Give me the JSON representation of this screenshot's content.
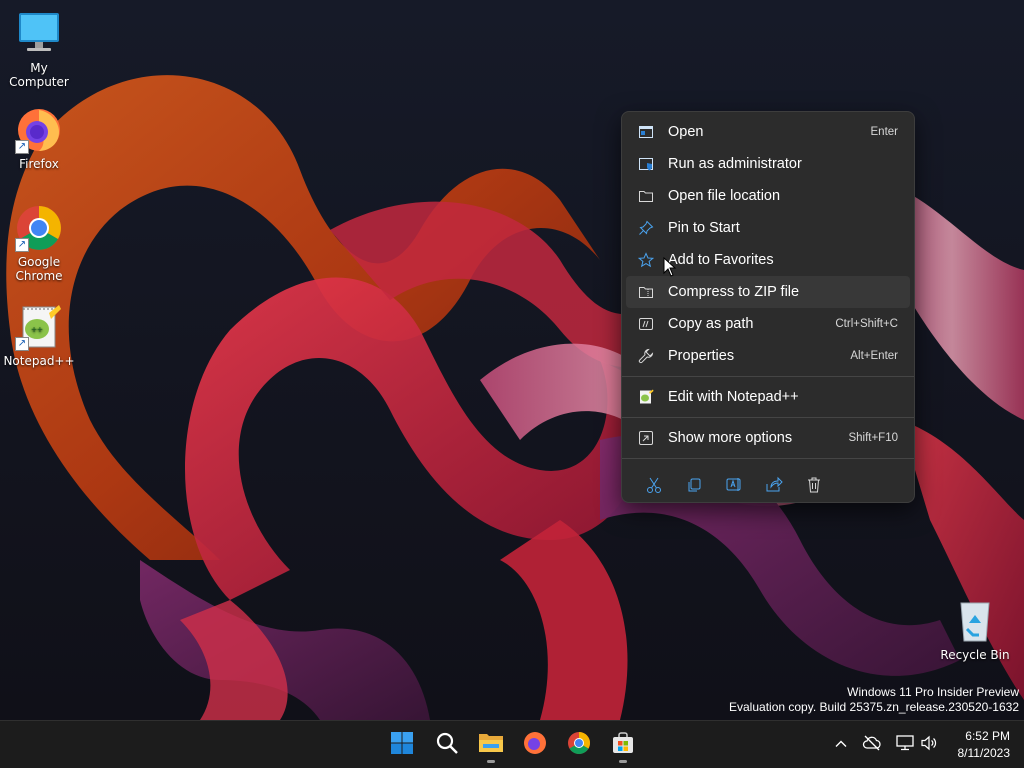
{
  "desktop": {
    "icons": [
      {
        "label": "My Computer",
        "icon": "monitor-icon"
      },
      {
        "label": "Firefox",
        "icon": "firefox-icon"
      },
      {
        "label": "Google Chrome",
        "icon": "chrome-icon"
      },
      {
        "label": "Notepad++",
        "icon": "notepad-plus-plus-icon"
      },
      {
        "label": "Recycle Bin",
        "icon": "recycle-bin-icon"
      }
    ]
  },
  "context_menu": {
    "items": [
      {
        "label": "Open",
        "shortcut": "Enter",
        "icon": "open-icon"
      },
      {
        "label": "Run as administrator",
        "shortcut": "",
        "icon": "admin-shield-icon"
      },
      {
        "label": "Open file location",
        "shortcut": "",
        "icon": "folder-icon"
      },
      {
        "label": "Pin to Start",
        "shortcut": "",
        "icon": "pin-icon"
      },
      {
        "label": "Add to Favorites",
        "shortcut": "",
        "icon": "star-icon"
      },
      {
        "label": "Compress to ZIP file",
        "shortcut": "",
        "icon": "zip-icon"
      },
      {
        "label": "Copy as path",
        "shortcut": "Ctrl+Shift+C",
        "icon": "copy-path-icon"
      },
      {
        "label": "Properties",
        "shortcut": "Alt+Enter",
        "icon": "wrench-icon"
      },
      {
        "label": "Edit with Notepad++",
        "shortcut": "",
        "icon": "notepad-plus-plus-icon"
      },
      {
        "label": "Show more options",
        "shortcut": "Shift+F10",
        "icon": "more-options-icon"
      }
    ],
    "quick_actions": [
      "cut-icon",
      "copy-icon",
      "rename-icon",
      "share-icon",
      "delete-icon"
    ]
  },
  "watermark": {
    "line1": "Windows 11 Pro Insider Preview",
    "line2": "Evaluation copy. Build 25375.zn_release.230520-1632"
  },
  "taskbar": {
    "apps": [
      "start-icon",
      "search-icon",
      "file-explorer-icon",
      "firefox-icon",
      "chrome-icon",
      "store-icon"
    ],
    "tray": [
      "chevron-up-icon",
      "onedrive-offline-icon",
      "network-icon",
      "volume-icon"
    ],
    "clock": {
      "time": "6:52 PM",
      "date": "8/11/2023"
    }
  },
  "colors": {
    "menu_bg": "#2c2c2c",
    "taskbar_bg": "#1c1c1c",
    "accent": "#0078d4"
  }
}
